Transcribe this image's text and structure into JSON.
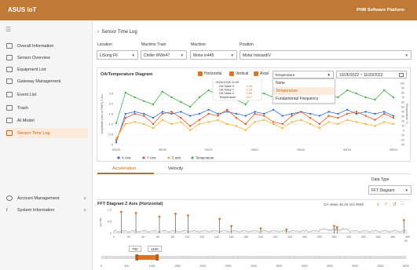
{
  "header": {
    "logo": "ASUS IoT",
    "platform": "PHM Software Platform",
    "accent": "#bf7a36"
  },
  "sidebar": {
    "items": [
      {
        "label": "Overall Information",
        "icon": "overall-icon"
      },
      {
        "label": "Sensor Overview",
        "icon": "sensor-icon"
      },
      {
        "label": "Equipment List",
        "icon": "equipment-icon"
      },
      {
        "label": "Gateway Management",
        "icon": "gateway-icon"
      },
      {
        "label": "Event List",
        "icon": "event-icon"
      },
      {
        "label": "Trash",
        "icon": "trash-icon"
      },
      {
        "label": "AI Model",
        "icon": "ai-icon"
      },
      {
        "label": "Sensor Time Log",
        "icon": "log-icon",
        "active": true
      }
    ],
    "bottom": [
      {
        "label": "Account Management",
        "icon": "account-icon"
      },
      {
        "label": "System Information",
        "icon": "info-icon"
      }
    ]
  },
  "page": {
    "breadcrumb": "Sensor Time Log"
  },
  "filters": {
    "location_label": "Location",
    "location": "LiSong F6",
    "train_label": "Machine Train",
    "train": "Chiller WWe47",
    "machine_label": "Machine",
    "machine": "Motor in445",
    "position_label": "Position",
    "position": "Motor Inboard/V"
  },
  "diagram": {
    "title": "OA/Temperature Diagram",
    "horizontal": "Horizontal",
    "vertical": "Vertical",
    "axial": "Axial",
    "dropdown_value": "Temperature",
    "dropdown_options": [
      "None",
      "Temperature",
      "Fundamental Frequency"
    ],
    "date_range": "10/26/2022 ~ 11/20/2022",
    "ylabel_left": "Amplitude (rms or RMS) Z Acc",
    "ylabel_right": "Temperature °C",
    "legend": [
      "X Axis",
      "Y Axis",
      "Z axis",
      "Temperature"
    ],
    "tooltip": {
      "date": "2024/10/26 11:00",
      "rows": [
        [
          "OA Value X",
          "2.45"
        ],
        [
          "OA Value Y",
          "1.24"
        ],
        [
          "OA Value Z",
          "0.85"
        ],
        [
          "Temperature",
          "24.7"
        ]
      ]
    }
  },
  "chart_data": [
    {
      "type": "line",
      "x": [
        "05/25",
        "",
        "",
        "",
        "",
        "05/30",
        "",
        "",
        "",
        "",
        "05/31",
        "",
        "",
        "",
        "",
        "06/01",
        "",
        "",
        "",
        "",
        "06/02",
        "",
        "",
        "",
        "",
        "06/03",
        "",
        "",
        "",
        "",
        "06/04"
      ],
      "xticks": [
        "05/25",
        "05/30",
        "05/31",
        "06/01",
        "06/02",
        "06/03",
        "06/04"
      ],
      "ylim": [
        0,
        3
      ],
      "yticks": [
        "0",
        "0.5",
        "1.0",
        "1.5",
        "2.0",
        "2.5"
      ],
      "ylim_right": [
        -30,
        100
      ],
      "yticks_right": [
        "100",
        "90",
        "80",
        "70",
        "60",
        "50",
        "40",
        "30",
        "20",
        "10",
        "0",
        "-10",
        "-20",
        "-30"
      ],
      "series": [
        {
          "name": "X Axis",
          "color": "#2f6fd6",
          "axis": "left",
          "values": [
            0.1,
            1.5,
            1.6,
            1.5,
            1.3,
            1.6,
            1.5,
            1.6,
            1.4,
            1.5,
            1.7,
            1.5,
            1.6,
            1.5,
            1.4,
            1.6,
            1.5,
            1.7,
            1.4,
            1.5,
            1.6,
            1.5,
            1.4,
            1.6,
            1.5,
            1.7,
            1.5,
            1.6,
            1.5,
            1.6,
            1.4
          ]
        },
        {
          "name": "Y Axis",
          "color": "#e0582a",
          "axis": "left",
          "values": [
            0.2,
            1.3,
            1.5,
            1.4,
            1.0,
            1.5,
            1.6,
            1.3,
            0.9,
            1.2,
            1.5,
            1.4,
            1.7,
            1.3,
            1.0,
            1.5,
            1.4,
            1.1,
            1.0,
            1.4,
            1.6,
            1.3,
            1.0,
            1.4,
            1.3,
            1.5,
            1.6,
            1.4,
            1.2,
            1.5,
            1.3
          ]
        },
        {
          "name": "Z axis",
          "color": "#f2b33b",
          "axis": "left",
          "values": [
            0.3,
            1.0,
            1.1,
            1.0,
            0.8,
            1.2,
            1.0,
            1.1,
            0.7,
            1.0,
            1.1,
            1.2,
            1.0,
            0.9,
            0.7,
            1.1,
            1.2,
            1.0,
            0.8,
            1.1,
            1.2,
            1.0,
            0.8,
            1.1,
            1.0,
            1.2,
            1.1,
            1.0,
            0.9,
            1.1,
            1.0
          ]
        },
        {
          "name": "Temperature",
          "color": "#4caf50",
          "axis": "right",
          "values": [
            15,
            80,
            70,
            62,
            55,
            82,
            70,
            60,
            50,
            70,
            85,
            75,
            70,
            65,
            55,
            80,
            78,
            70,
            60,
            72,
            85,
            75,
            62,
            75,
            70,
            85,
            78,
            70,
            65,
            85,
            70
          ]
        }
      ]
    },
    {
      "type": "bar",
      "title": "FFT Diagram  Z Axis (Horizontal)",
      "ylabel": "g (rms)",
      "xlim": [
        0,
        400
      ],
      "ylim": [
        0,
        1.0
      ],
      "xticks": [
        "0",
        "20",
        "40",
        "60",
        "80",
        "100",
        "120",
        "140",
        "160",
        "180",
        "200",
        "220",
        "240",
        "260",
        "280",
        "300",
        "320",
        "340",
        "360",
        "380",
        "400"
      ],
      "xunit": "Hz",
      "yticks": [
        "0",
        "0.5",
        "1.0"
      ],
      "peaks": [
        [
          10,
          0.9
        ],
        [
          30,
          0.85
        ],
        [
          62,
          0.7
        ],
        [
          84,
          0.82
        ],
        [
          101,
          0.75
        ],
        [
          144,
          0.6
        ],
        [
          160,
          0.3
        ],
        [
          200,
          0.2
        ],
        [
          235,
          0.15
        ],
        [
          300,
          0.3
        ],
        [
          304,
          0.25
        ],
        [
          395,
          0.55
        ]
      ],
      "peak_color": "#d9742a"
    }
  ],
  "tabs": [
    "Acceleration",
    "Velocity"
  ],
  "fft": {
    "data_type_label": "Data Type",
    "data_type": "FFT Diagram",
    "title": "FFT Diagram  Z Axis (Horizontal)",
    "oa_value": "OA Value 45.45 m/s RMS",
    "range_low": "700",
    "range_high": "1100",
    "slider_ticks": [
      "0",
      "500",
      "1000",
      "1500",
      "2000",
      "2500",
      "3000",
      "3500",
      "4000",
      "4500",
      "5000",
      "5500",
      "6000"
    ]
  }
}
